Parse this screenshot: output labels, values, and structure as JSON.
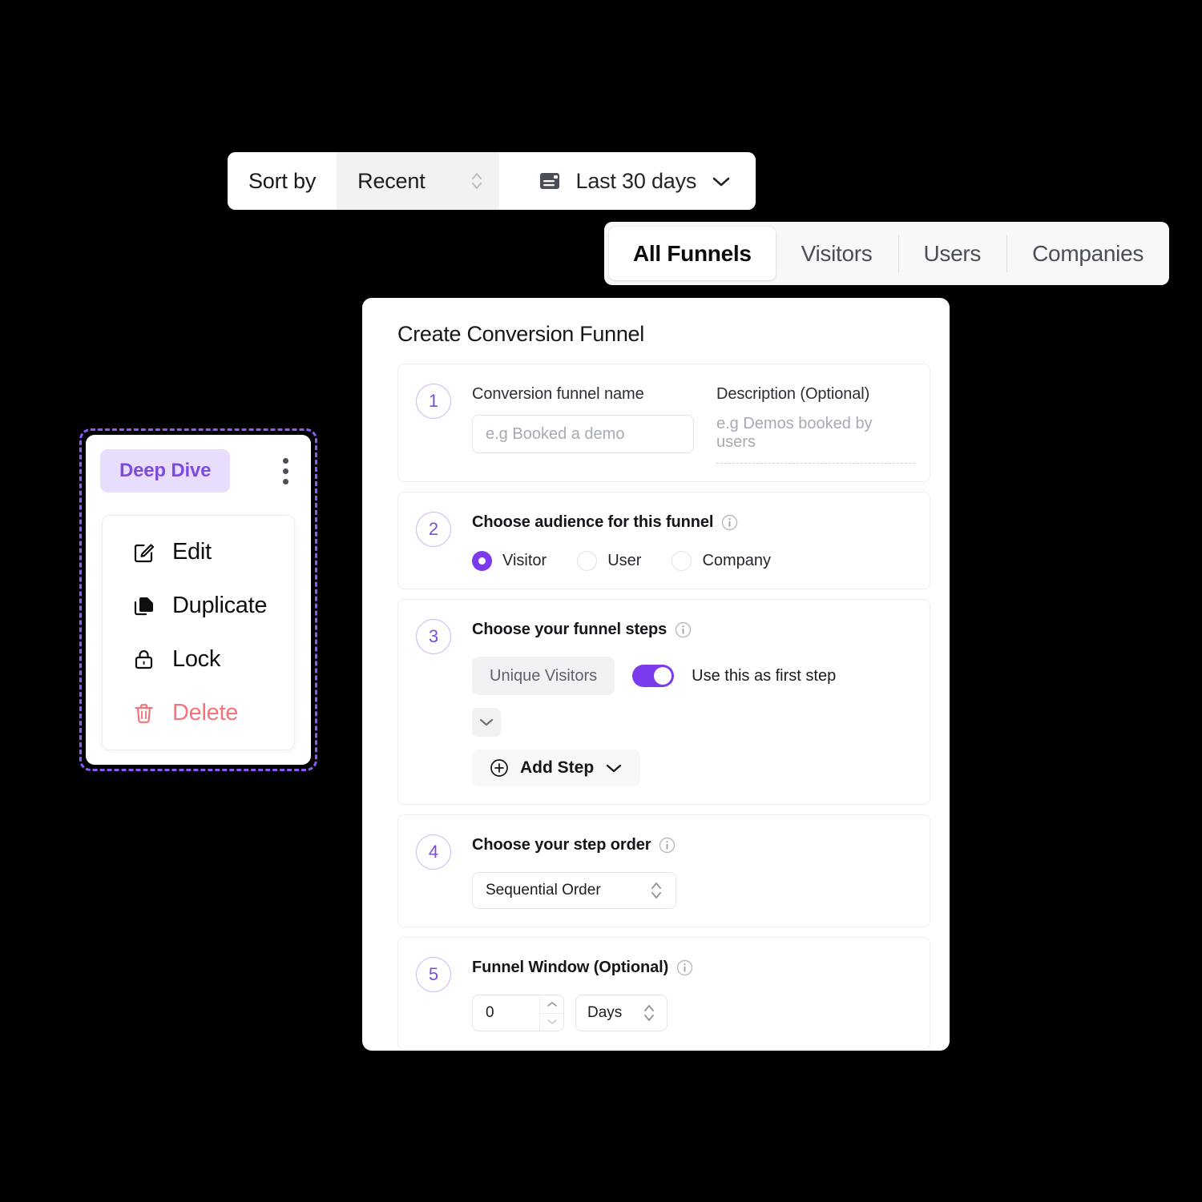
{
  "toolbar": {
    "sort_label": "Sort by",
    "sort_value": "Recent",
    "date_range": "Last 30 days",
    "calendar_icon": "calendar-icon",
    "updown_icon": "up-down-chevron-icon",
    "chevron_icon": "chevron-down-icon"
  },
  "tabs": [
    {
      "label": "All Funnels",
      "active": true
    },
    {
      "label": "Visitors",
      "active": false
    },
    {
      "label": "Users",
      "active": false
    },
    {
      "label": "Companies",
      "active": false
    }
  ],
  "card": {
    "title": "Create Conversion Funnel",
    "sections": [
      {
        "number": "1",
        "name_label": "Conversion funnel name",
        "name_placeholder": "e.g Booked a demo",
        "desc_label": "Description (Optional)",
        "desc_placeholder": "e.g Demos booked by users"
      },
      {
        "number": "2",
        "heading": "Choose audience for this funnel",
        "info_icon": "info-icon",
        "options": [
          {
            "label": "Visitor",
            "selected": true
          },
          {
            "label": "User",
            "selected": false
          },
          {
            "label": "Company",
            "selected": false
          }
        ]
      },
      {
        "number": "3",
        "heading": "Choose your funnel steps",
        "info_icon": "info-icon",
        "step_chip": "Unique Visitors",
        "toggle_on": true,
        "toggle_label": "Use this as first step",
        "expand_icon": "chevron-down-icon",
        "add_step_label": "Add Step",
        "plus_icon": "plus-circle-icon"
      },
      {
        "number": "4",
        "heading": "Choose your step order",
        "info_icon": "info-icon",
        "order_value": "Sequential Order"
      },
      {
        "number": "5",
        "heading": "Funnel Window (Optional)",
        "info_icon": "info-icon",
        "window_value": "0",
        "window_unit": "Days"
      }
    ]
  },
  "context_menu": {
    "badge": "Deep Dive",
    "kebab_icon": "more-vertical-icon",
    "items": [
      {
        "label": "Edit",
        "icon": "edit-pencil-icon",
        "danger": false
      },
      {
        "label": "Duplicate",
        "icon": "duplicate-copy-icon",
        "danger": false
      },
      {
        "label": "Lock",
        "icon": "lock-icon",
        "danger": false
      },
      {
        "label": "Delete",
        "icon": "trash-delete-icon",
        "danger": true
      }
    ]
  },
  "colors": {
    "accent_purple": "#7c3aed",
    "badge_bg": "#e9ddfd",
    "badge_text": "#7c4ddb",
    "danger_red": "#f5737a",
    "background": "#000000",
    "surface": "#ffffff"
  }
}
